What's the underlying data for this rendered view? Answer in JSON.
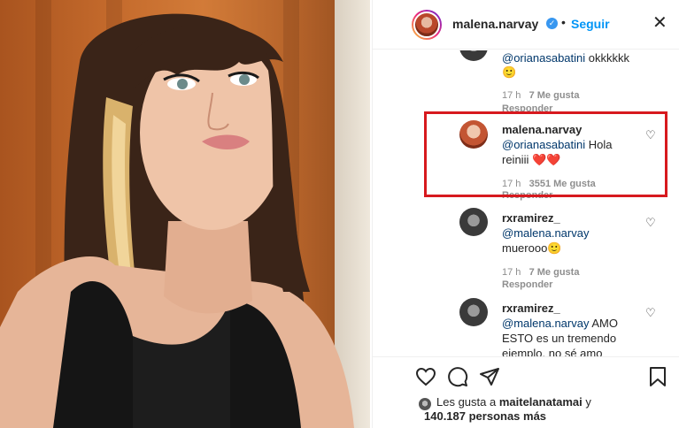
{
  "post": {
    "author": "malena.narvay",
    "follow_label": "Seguir",
    "separator": "•"
  },
  "comments": [
    {
      "mention": "@orianasabatini",
      "text": "okkkkkk",
      "emoji": "🙂",
      "time": "17 h",
      "likes": "7 Me gusta",
      "reply": "Responder"
    },
    {
      "username": "malena.narvay",
      "mention": "@orianasabatini",
      "text_1": "Hola",
      "text_2": "reiniii",
      "emoji": "❤️❤️",
      "time": "17 h",
      "likes": "3551 Me gusta",
      "reply": "Responder"
    },
    {
      "username": "rxramirez_",
      "mention": "@malena.narvay",
      "text": "muerooo",
      "emoji": "🙂",
      "time": "17 h",
      "likes": "7 Me gusta",
      "reply": "Responder"
    },
    {
      "username": "rxramirez_",
      "mention": "@malena.narvay",
      "text_1": "AMO",
      "text_2": "ESTO es un tremendo",
      "text_3": "ejemplo, no sé amo"
    }
  ],
  "likes_summary": {
    "prefix": "Les gusta a",
    "user": "maitelanatamai",
    "conj": "y",
    "count": "140.187 personas más"
  },
  "icons": [
    "close-icon",
    "verified-icon",
    "heart-icon",
    "comment-icon",
    "share-icon",
    "bookmark-icon"
  ],
  "colors": {
    "accent": "#0095f6",
    "mention": "#00376b",
    "highlight": "#d7191e",
    "muted": "#8e8e8e"
  }
}
